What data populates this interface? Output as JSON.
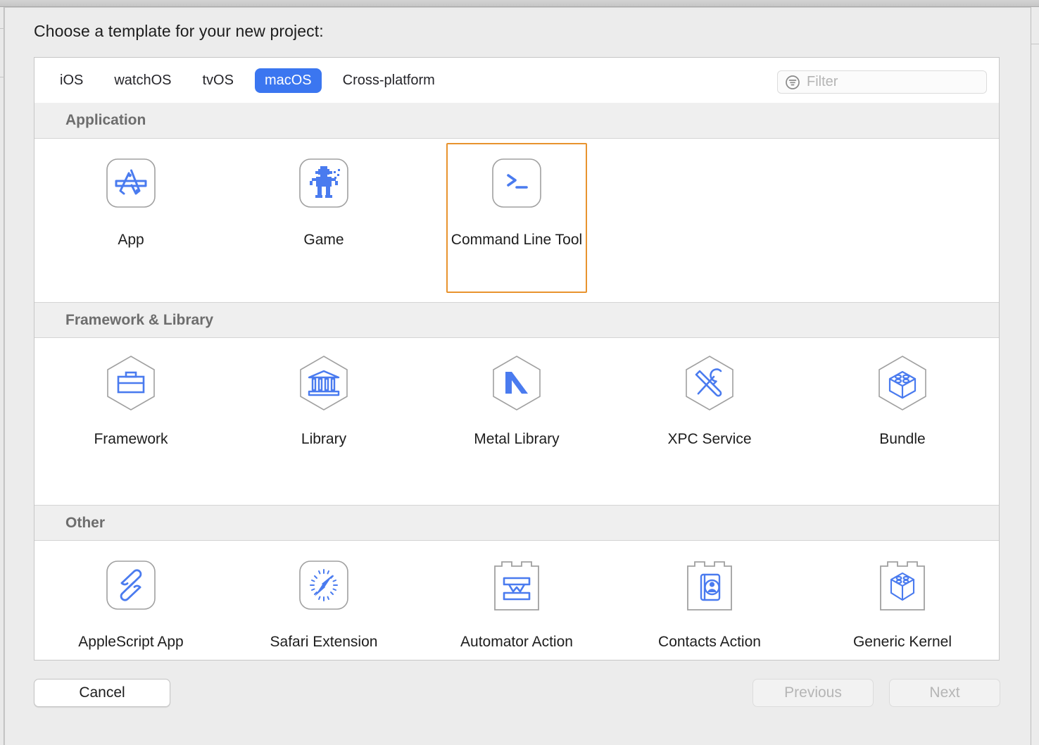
{
  "dialog": {
    "prompt": "Choose a template for your new project:"
  },
  "toolbar": {
    "tabs": [
      {
        "label": "iOS",
        "active": false
      },
      {
        "label": "watchOS",
        "active": false
      },
      {
        "label": "tvOS",
        "active": false
      },
      {
        "label": "macOS",
        "active": true
      },
      {
        "label": "Cross-platform",
        "active": false
      }
    ],
    "filter": {
      "value": "",
      "placeholder": "Filter",
      "icon": "filter-icon"
    }
  },
  "sections": [
    {
      "title": "Application",
      "items": [
        {
          "label": "App",
          "icon": "app-store-icon",
          "selected": false
        },
        {
          "label": "Game",
          "icon": "game-robot-icon",
          "selected": false
        },
        {
          "label": "Command Line Tool",
          "icon": "terminal-prompt-icon",
          "selected": true
        }
      ]
    },
    {
      "title": "Framework & Library",
      "items": [
        {
          "label": "Framework",
          "icon": "briefcase-hexagon-icon",
          "selected": false
        },
        {
          "label": "Library",
          "icon": "bank-columns-hexagon-icon",
          "selected": false
        },
        {
          "label": "Metal Library",
          "icon": "metal-m-hexagon-icon",
          "selected": false
        },
        {
          "label": "XPC Service",
          "icon": "tools-hexagon-icon",
          "selected": false
        },
        {
          "label": "Bundle",
          "icon": "box-studs-hexagon-icon",
          "selected": false
        }
      ]
    },
    {
      "title": "Other",
      "items": [
        {
          "label": "AppleScript App",
          "icon": "applescript-scroll-icon",
          "selected": false
        },
        {
          "label": "Safari Extension",
          "icon": "safari-compass-icon",
          "selected": false
        },
        {
          "label": "Automator Action",
          "icon": "automator-plugin-icon",
          "selected": false
        },
        {
          "label": "Contacts Action",
          "icon": "contacts-book-plugin-icon",
          "selected": false
        },
        {
          "label": "Generic Kernel",
          "icon": "kernel-box-plugin-icon",
          "selected": false
        }
      ]
    }
  ],
  "footer": {
    "cancel": {
      "label": "Cancel",
      "enabled": true
    },
    "previous": {
      "label": "Previous",
      "enabled": false
    },
    "next": {
      "label": "Next",
      "enabled": false
    }
  },
  "colors": {
    "accent_blue": "#3b76f0",
    "selection_orange": "#e8932e",
    "icon_blue": "#4a7bef",
    "icon_outline": "#a0a0a0",
    "section_header_bg": "#efefef",
    "window_bg": "#ececec"
  }
}
